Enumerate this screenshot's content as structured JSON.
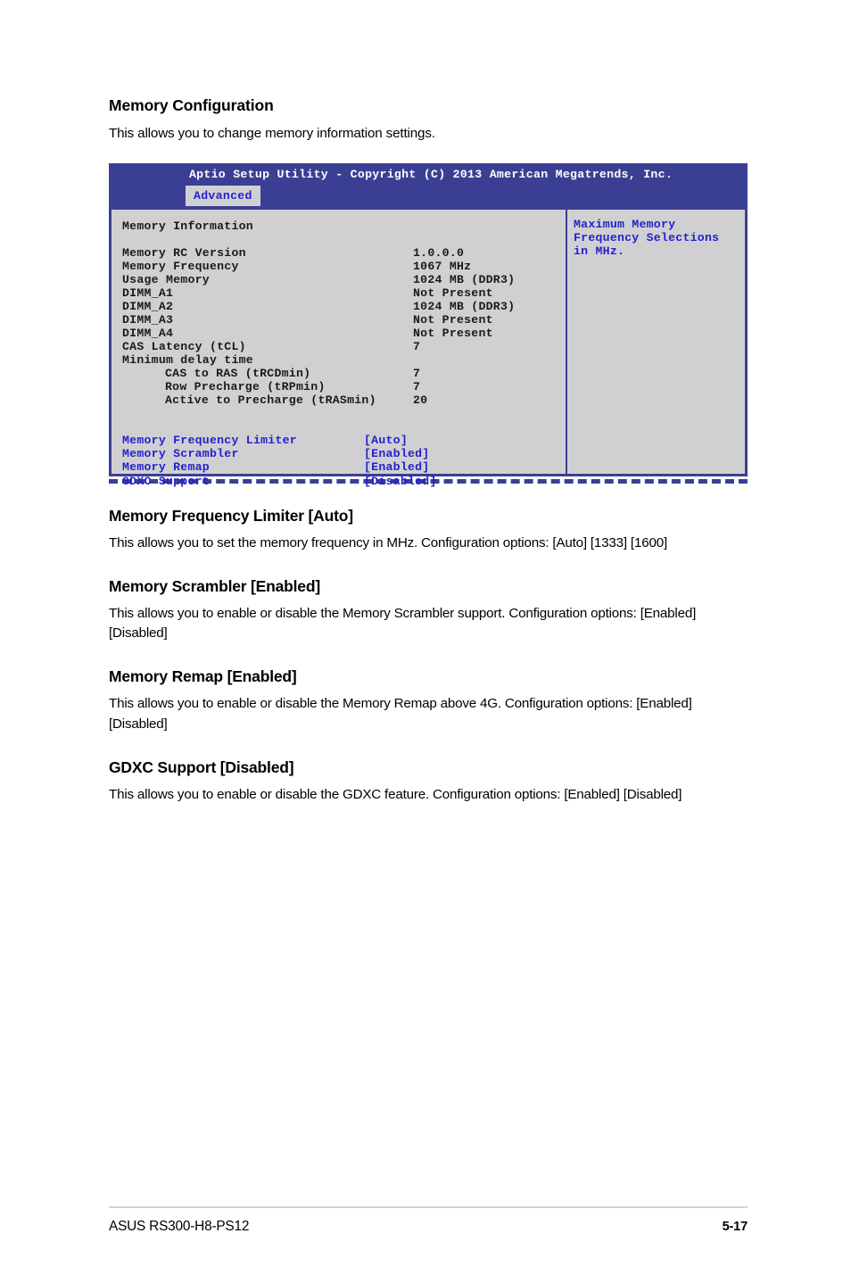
{
  "page": {
    "section_title": "Memory Configuration",
    "section_intro": "This allows you to change memory information settings."
  },
  "bios": {
    "title": "Aptio Setup Utility - Copyright (C) 2013 American Megatrends, Inc.",
    "active_tab": "Advanced",
    "group_heading": "Memory Information",
    "info_rows": [
      {
        "label": "Memory RC Version",
        "value": "1.0.0.0",
        "indent": false
      },
      {
        "label": "Memory Frequency",
        "value": "1067 MHz",
        "indent": false
      },
      {
        "label": "Usage Memory",
        "value": "1024 MB (DDR3)",
        "indent": false
      },
      {
        "label": "DIMM_A1",
        "value": "Not Present",
        "indent": false
      },
      {
        "label": "DIMM_A2",
        "value": "1024 MB (DDR3)",
        "indent": false
      },
      {
        "label": "DIMM_A3",
        "value": "Not Present",
        "indent": false
      },
      {
        "label": "DIMM_A4",
        "value": "Not Present",
        "indent": false
      },
      {
        "label": "CAS Latency (tCL)",
        "value": "7",
        "indent": false
      },
      {
        "label": "Minimum delay time",
        "value": "",
        "indent": false
      },
      {
        "label": "CAS to RAS (tRCDmin)",
        "value": "7",
        "indent": true
      },
      {
        "label": "Row Precharge (tRPmin)",
        "value": "7",
        "indent": true
      },
      {
        "label": "Active to Precharge (tRASmin)",
        "value": "20",
        "indent": true
      }
    ],
    "options": [
      {
        "label": "Memory Frequency Limiter",
        "value": "[Auto]"
      },
      {
        "label": "Memory Scrambler",
        "value": "[Enabled]"
      },
      {
        "label": "Memory Remap",
        "value": "[Enabled]"
      },
      {
        "label": "GDXC Support",
        "value": "[Disabled]"
      }
    ],
    "help_lines": [
      "Maximum Memory",
      "Frequency Selections",
      "in MHz."
    ],
    "colors": {
      "chrome_blue": "#3b3f93",
      "panel_gray": "#d0d0d3",
      "accent_text_blue": "#2222cc"
    }
  },
  "sections": [
    {
      "heading": "Memory Frequency Limiter [Auto]",
      "body": "This allows you to set the memory frequency in MHz. Configuration options: [Auto] [1333] [1600]"
    },
    {
      "heading": "Memory Scrambler [Enabled]",
      "body": "This allows you to enable or disable the Memory Scrambler support. Configuration options: [Enabled] [Disabled]"
    },
    {
      "heading": "Memory Remap [Enabled]",
      "body": "This allows you to enable or disable the Memory Remap above 4G. Configuration options: [Enabled] [Disabled]"
    },
    {
      "heading": "GDXC Support [Disabled]",
      "body": "This allows you to enable or disable the GDXC feature. Configuration options: [Enabled] [Disabled]"
    }
  ],
  "footer": {
    "book_title": "ASUS RS300-H8-PS12",
    "page_number": "5-17"
  }
}
